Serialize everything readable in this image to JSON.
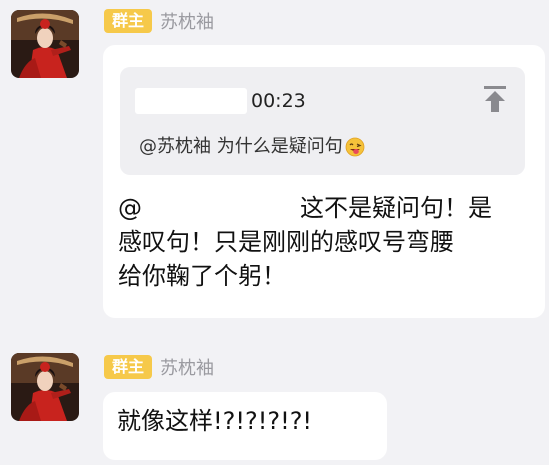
{
  "messages": [
    {
      "role_badge": "群主",
      "sender": "苏枕袖",
      "quote": {
        "time": "00:23",
        "text": "@苏枕袖 为什么是疑问句",
        "emoji_icon": "grinning-tongue-emoji-icon"
      },
      "reply": {
        "mention": "@",
        "line1": "这不是疑问句！是",
        "line2": "感叹句！只是刚刚的感叹号弯腰",
        "line3": "给你鞠了个躬！"
      }
    },
    {
      "role_badge": "群主",
      "sender": "苏枕袖",
      "text": "就像这样!?!?!?!?!"
    }
  ],
  "colors": {
    "background": "#f2f2f5",
    "bubble": "#ffffff",
    "quote_background": "#efeff2",
    "badge": "#f6c94a",
    "sender_name": "#9a9aa0"
  }
}
